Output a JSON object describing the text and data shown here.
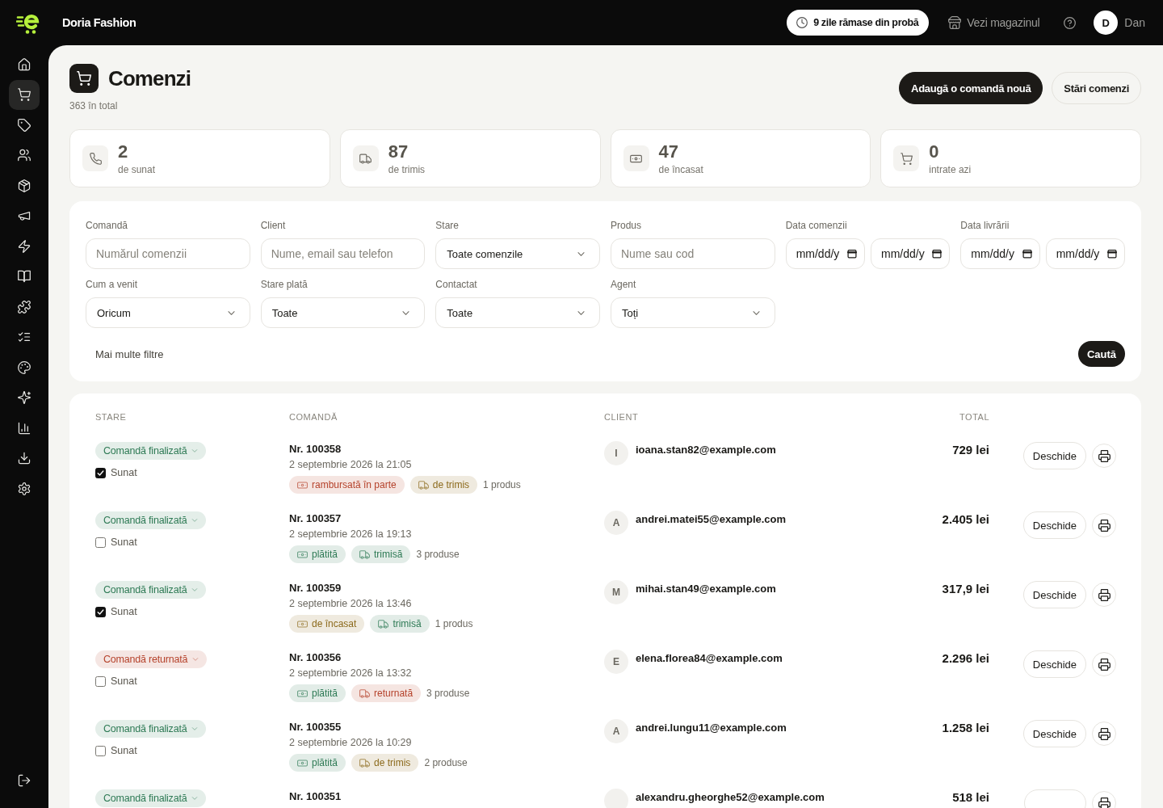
{
  "topbar": {
    "brand": "Doria Fashion",
    "trial_badge": "9 zile rămase din probă",
    "store_link": "Vezi magazinul",
    "user": {
      "initial": "D",
      "name": "Dan"
    }
  },
  "sidebar": {
    "items": [
      {
        "selected": false
      },
      {
        "selected": true
      },
      {
        "selected": false
      },
      {
        "selected": false
      },
      {
        "selected": false
      },
      {
        "selected": false
      },
      {
        "selected": false
      },
      {
        "selected": false
      },
      {
        "selected": false
      },
      {
        "selected": false
      },
      {
        "selected": false
      },
      {
        "selected": false
      },
      {
        "selected": false
      },
      {
        "selected": false
      },
      {
        "selected": false
      }
    ]
  },
  "page": {
    "title": "Comenzi",
    "subtitle": "363 în total",
    "actions": [
      {
        "kind": "primary",
        "label": "Adaugă o comandă nouă"
      },
      {
        "kind": "secondary",
        "label": "Stări comenzi"
      }
    ]
  },
  "stats": [
    {
      "value": "2",
      "label": "de sunat"
    },
    {
      "value": "87",
      "label": "de trimis"
    },
    {
      "value": "47",
      "label": "de încasat"
    },
    {
      "value": "0",
      "label": "intrate azi"
    }
  ],
  "filters": {
    "fields": [
      {
        "kind": "text",
        "label": "Comandă",
        "placeholder": "Numărul comenzii"
      },
      {
        "kind": "text",
        "label": "Client",
        "placeholder": "Nume, email sau telefon"
      },
      {
        "kind": "select",
        "label": "Stare",
        "value": "Toate comenzile"
      },
      {
        "kind": "text",
        "label": "Produs",
        "placeholder": "Nume sau cod"
      },
      {
        "kind": "date_range",
        "label": "Data comenzii",
        "inputs": [
          {
            "placeholder": "mm/dd/y"
          },
          {
            "placeholder": "mm/dd/y"
          }
        ]
      },
      {
        "kind": "date_range",
        "label": "Data livrării",
        "inputs": [
          {
            "placeholder": "mm/dd/y"
          },
          {
            "placeholder": "mm/dd/y"
          }
        ]
      },
      {
        "kind": "select",
        "label": "Cum a venit",
        "value": "Oricum"
      },
      {
        "kind": "select",
        "label": "Stare plată",
        "value": "Toate"
      },
      {
        "kind": "select",
        "label": "Contactat",
        "value": "Toate"
      },
      {
        "kind": "select",
        "label": "Agent",
        "value": "Toți"
      }
    ],
    "more_filters": "Mai multe filtre",
    "search_button": "Caută"
  },
  "table": {
    "columns": [
      "STARE",
      "COMANDĂ",
      "CLIENT",
      "TOTAL"
    ],
    "rows": [
      {
        "status": {
          "label": "Comandă finalizată",
          "color": "#2e7a55"
        },
        "called": {
          "label": "Sunat",
          "checked": true
        },
        "order_no": "Nr. 100358",
        "date": "2 septembrie 2026 la 21:05",
        "tags": [
          {
            "kind": "payment",
            "label": "rambursată în parte",
            "color": "#b5422b"
          },
          {
            "kind": "shipping",
            "label": "de trimis",
            "color": "#8c6a1c"
          }
        ],
        "items": "1 produs",
        "client": {
          "initial": "I",
          "email": "ioana.stan82@example.com"
        },
        "total": "729 lei",
        "open_button": "Deschide"
      },
      {
        "status": {
          "label": "Comandă finalizată",
          "color": "#2e7a55"
        },
        "called": {
          "label": "Sunat",
          "checked": false
        },
        "order_no": "Nr. 100357",
        "date": "2 septembrie 2026 la 19:13",
        "tags": [
          {
            "kind": "payment",
            "label": "plătită",
            "color": "#2e7a55"
          },
          {
            "kind": "shipping",
            "label": "trimisă",
            "color": "#2e7a55"
          }
        ],
        "items": "3 produse",
        "client": {
          "initial": "A",
          "email": "andrei.matei55@example.com"
        },
        "total": "2.405 lei",
        "open_button": "Deschide"
      },
      {
        "status": {
          "label": "Comandă finalizată",
          "color": "#2e7a55"
        },
        "called": {
          "label": "Sunat",
          "checked": true
        },
        "order_no": "Nr. 100359",
        "date": "2 septembrie 2026 la 13:46",
        "tags": [
          {
            "kind": "payment",
            "label": "de încasat",
            "color": "#8c6a1c"
          },
          {
            "kind": "shipping",
            "label": "trimisă",
            "color": "#2e7a55"
          }
        ],
        "items": "1 produs",
        "client": {
          "initial": "M",
          "email": "mihai.stan49@example.com"
        },
        "total": "317,9 lei",
        "open_button": "Deschide"
      },
      {
        "status": {
          "label": "Comandă returnată",
          "color": "#b5422b"
        },
        "called": {
          "label": "Sunat",
          "checked": false
        },
        "order_no": "Nr. 100356",
        "date": "2 septembrie 2026 la 13:32",
        "tags": [
          {
            "kind": "payment",
            "label": "plătită",
            "color": "#2e7a55"
          },
          {
            "kind": "shipping",
            "label": "returnată",
            "color": "#b5422b"
          }
        ],
        "items": "3 produse",
        "client": {
          "initial": "E",
          "email": "elena.florea84@example.com"
        },
        "total": "2.296 lei",
        "open_button": "Deschide"
      },
      {
        "status": {
          "label": "Comandă finalizată",
          "color": "#2e7a55"
        },
        "called": {
          "label": "Sunat",
          "checked": false
        },
        "order_no": "Nr. 100355",
        "date": "2 septembrie 2026 la 10:29",
        "tags": [
          {
            "kind": "payment",
            "label": "plătită",
            "color": "#2e7a55"
          },
          {
            "kind": "shipping",
            "label": "de trimis",
            "color": "#8c6a1c"
          }
        ],
        "items": "2 produse",
        "client": {
          "initial": "A",
          "email": "andrei.lungu11@example.com"
        },
        "total": "1.258 lei",
        "open_button": "Deschide"
      },
      {
        "status": {
          "label": "Comandă finalizată",
          "color": "#2e7a55"
        },
        "order_no": "Nr. 100351",
        "client": {
          "email": "alexandru.gheorghe52@example.com"
        },
        "total": "518 lei"
      }
    ]
  }
}
